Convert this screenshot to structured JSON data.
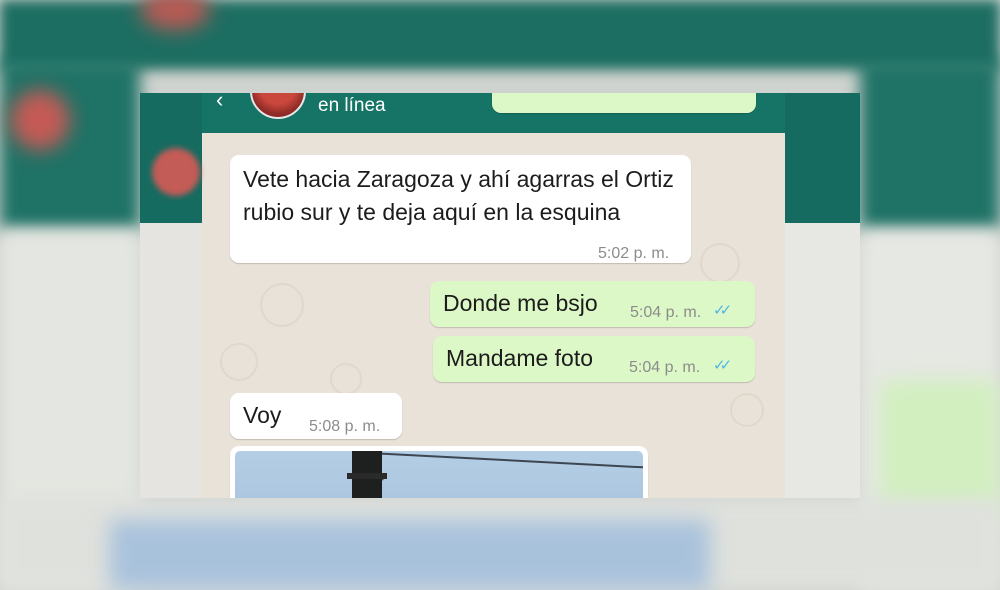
{
  "header": {
    "status": "en línea",
    "back_icon": "back-arrow-icon",
    "icons": [
      "video-call-icon",
      "phone-call-icon",
      "more-options-icon"
    ]
  },
  "messages": [
    {
      "direction": "incoming",
      "text": "Vete hacia Zaragoza y ahí agarras el Ortiz rubio sur y te deja aquí en la esquina",
      "time": "5:02 p. m."
    },
    {
      "direction": "outgoing",
      "text": "Donde me bsjo",
      "time": "5:04 p. m.",
      "ticks": "✓✓"
    },
    {
      "direction": "outgoing",
      "text": "Mandame foto",
      "time": "5:04 p. m.",
      "ticks": "✓✓"
    },
    {
      "direction": "incoming",
      "text": "Voy",
      "time": "5:08 p. m."
    }
  ],
  "colors": {
    "header": "#167466",
    "incoming_bubble": "#ffffff",
    "outgoing_bubble": "#dcf8c6",
    "read_ticks": "#4fb6ec",
    "chat_background": "#e9e2d8"
  }
}
